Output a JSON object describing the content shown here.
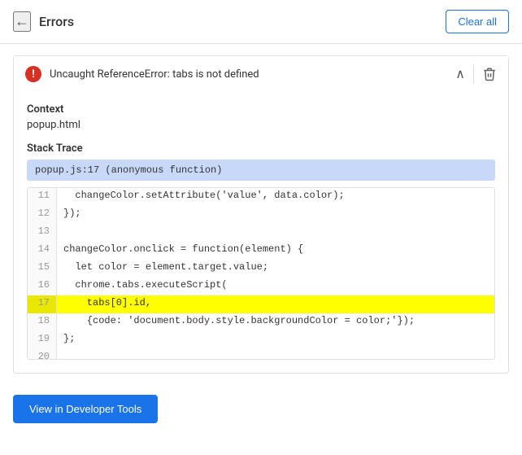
{
  "header": {
    "back_label": "←",
    "title": "Errors",
    "clear_all_label": "Clear all"
  },
  "error": {
    "icon_label": "!",
    "message": "Uncaught ReferenceError: tabs is not defined",
    "chevron": "∧",
    "delete_icon": "🗑"
  },
  "context": {
    "label": "Context",
    "value": "popup.html"
  },
  "stack_trace": {
    "label": "Stack Trace",
    "entry": "popup.js:17 (anonymous function)"
  },
  "code": {
    "lines": [
      {
        "num": "11",
        "text": "  changeColor.setAttribute('value', data.color);",
        "highlight": false
      },
      {
        "num": "12",
        "text": "});",
        "highlight": false
      },
      {
        "num": "13",
        "text": "",
        "highlight": false
      },
      {
        "num": "14",
        "text": "changeColor.onclick = function(element) {",
        "highlight": false
      },
      {
        "num": "15",
        "text": "  let color = element.target.value;",
        "highlight": false
      },
      {
        "num": "16",
        "text": "  chrome.tabs.executeScript(",
        "highlight": false
      },
      {
        "num": "17",
        "text": "    tabs[0].id,",
        "highlight": true
      },
      {
        "num": "18",
        "text": "    {code: 'document.body.style.backgroundColor = color;'});",
        "highlight": false
      },
      {
        "num": "19",
        "text": "};",
        "highlight": false
      },
      {
        "num": "20",
        "text": "",
        "highlight": false
      }
    ]
  },
  "footer": {
    "view_devtools_label": "View in Developer Tools"
  }
}
